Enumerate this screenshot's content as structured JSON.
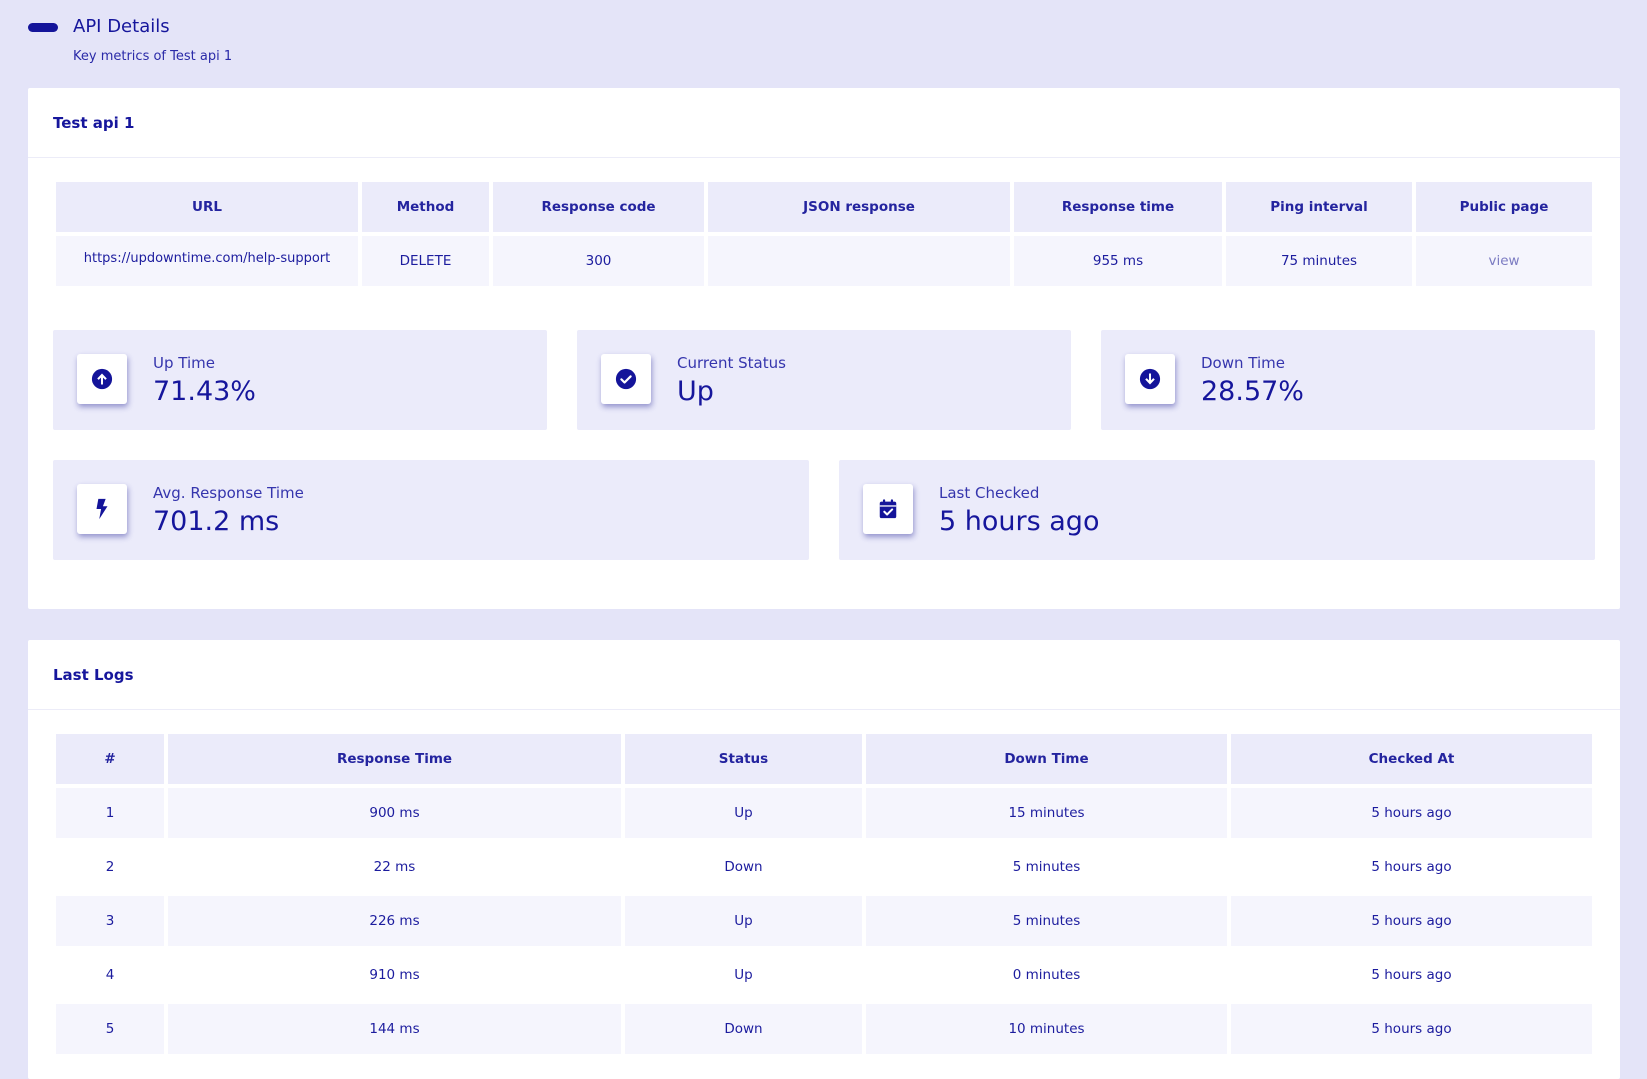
{
  "header": {
    "title": "API Details",
    "subtitle": "Key metrics of Test api 1"
  },
  "details_card": {
    "title": "Test api 1",
    "columns": [
      "URL",
      "Method",
      "Response code",
      "JSON response",
      "Response time",
      "Ping interval",
      "Public page"
    ],
    "row": {
      "url": "https://updowntime.com/help-support",
      "method": "DELETE",
      "response_code": "300",
      "json_response": "",
      "response_time": "955 ms",
      "ping_interval": "75 minutes",
      "public_page": "view"
    }
  },
  "stats": {
    "up_time": {
      "label": "Up Time",
      "value": "71.43%",
      "icon": "arrow-up-circle-icon"
    },
    "current_status": {
      "label": "Current Status",
      "value": "Up",
      "icon": "check-circle-icon"
    },
    "down_time": {
      "label": "Down Time",
      "value": "28.57%",
      "icon": "arrow-down-circle-icon"
    },
    "avg_response": {
      "label": "Avg. Response Time",
      "value": "701.2 ms",
      "icon": "bolt-icon"
    },
    "last_checked": {
      "label": "Last Checked",
      "value": "5 hours ago",
      "icon": "calendar-check-icon"
    }
  },
  "logs_card": {
    "title": "Last Logs",
    "columns": [
      "#",
      "Response Time",
      "Status",
      "Down Time",
      "Checked At"
    ],
    "rows": [
      {
        "num": "1",
        "response_time": "900 ms",
        "status": "Up",
        "down_time": "15 minutes",
        "checked_at": "5 hours ago"
      },
      {
        "num": "2",
        "response_time": "22 ms",
        "status": "Down",
        "down_time": "5 minutes",
        "checked_at": "5 hours ago"
      },
      {
        "num": "3",
        "response_time": "226 ms",
        "status": "Up",
        "down_time": "5 minutes",
        "checked_at": "5 hours ago"
      },
      {
        "num": "4",
        "response_time": "910 ms",
        "status": "Up",
        "down_time": "0 minutes",
        "checked_at": "5 hours ago"
      },
      {
        "num": "5",
        "response_time": "144 ms",
        "status": "Down",
        "down_time": "10 minutes",
        "checked_at": "5 hours ago"
      }
    ]
  },
  "colors": {
    "background": "#e4e4f8",
    "accent": "#16169c",
    "table_header": "#ebebfa",
    "table_row": "#f5f5fd",
    "link": "#7b7bc2"
  }
}
